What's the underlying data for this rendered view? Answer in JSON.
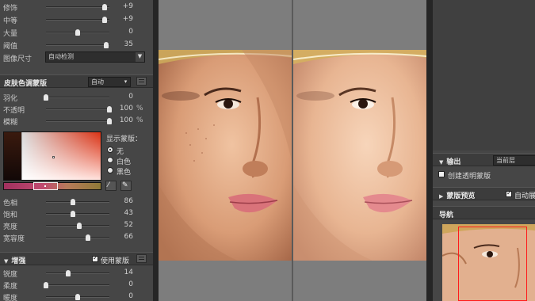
{
  "left_panel": {
    "top_sliders": [
      {
        "label": "修饰",
        "value": "+9",
        "pos": 0.92
      },
      {
        "label": "中等",
        "value": "+9",
        "pos": 0.92
      },
      {
        "label": "大量",
        "value": "0",
        "pos": 0.5
      },
      {
        "label": "阈值",
        "value": "35",
        "pos": 0.95
      }
    ],
    "image_size": {
      "label": "图像尺寸",
      "value": "自动检测"
    },
    "skin_mask": {
      "title": "皮肤色调蒙版",
      "mode": "自动",
      "sliders": [
        {
          "label": "羽化",
          "value": "0",
          "unit": "",
          "pos": 0.0
        },
        {
          "label": "不透明",
          "value": "100",
          "unit": "%",
          "pos": 1.0
        },
        {
          "label": "模糊",
          "value": "100",
          "unit": "%",
          "pos": 1.0
        }
      ],
      "display_mask_label": "显示蒙版：",
      "display_options": [
        {
          "label": "无",
          "selected": true
        },
        {
          "label": "白色",
          "selected": false
        },
        {
          "label": "黑色",
          "selected": false
        }
      ],
      "hsl_sliders": [
        {
          "label": "色相",
          "value": "86",
          "pos": 0.42
        },
        {
          "label": "饱和",
          "value": "43",
          "pos": 0.42
        },
        {
          "label": "亮度",
          "value": "52",
          "pos": 0.52
        },
        {
          "label": "宽容度",
          "value": "66",
          "pos": 0.66
        }
      ]
    },
    "enhance": {
      "title": "增强",
      "use_mask_label": "使用蒙版",
      "use_mask_checked": true,
      "sliders": [
        {
          "label": "锐度",
          "value": "14",
          "pos": 0.35
        },
        {
          "label": "柔度",
          "value": "0",
          "pos": 0.0
        },
        {
          "label": "暖度",
          "value": "0",
          "pos": 0.5
        }
      ]
    }
  },
  "right_panel": {
    "output": {
      "title": "输出",
      "mode": "当前层",
      "create_mask_label": "创建透明蒙版"
    },
    "mask_preview": {
      "title": "蒙版预览",
      "auto_label": "自动展"
    },
    "navigator": {
      "title": "导航"
    }
  },
  "colors": {
    "panel_bg": "#464646",
    "header_bg": "#3c3c3c",
    "canvas_bg": "#7d7d7d",
    "nav_highlight": "#ff1a1a"
  }
}
